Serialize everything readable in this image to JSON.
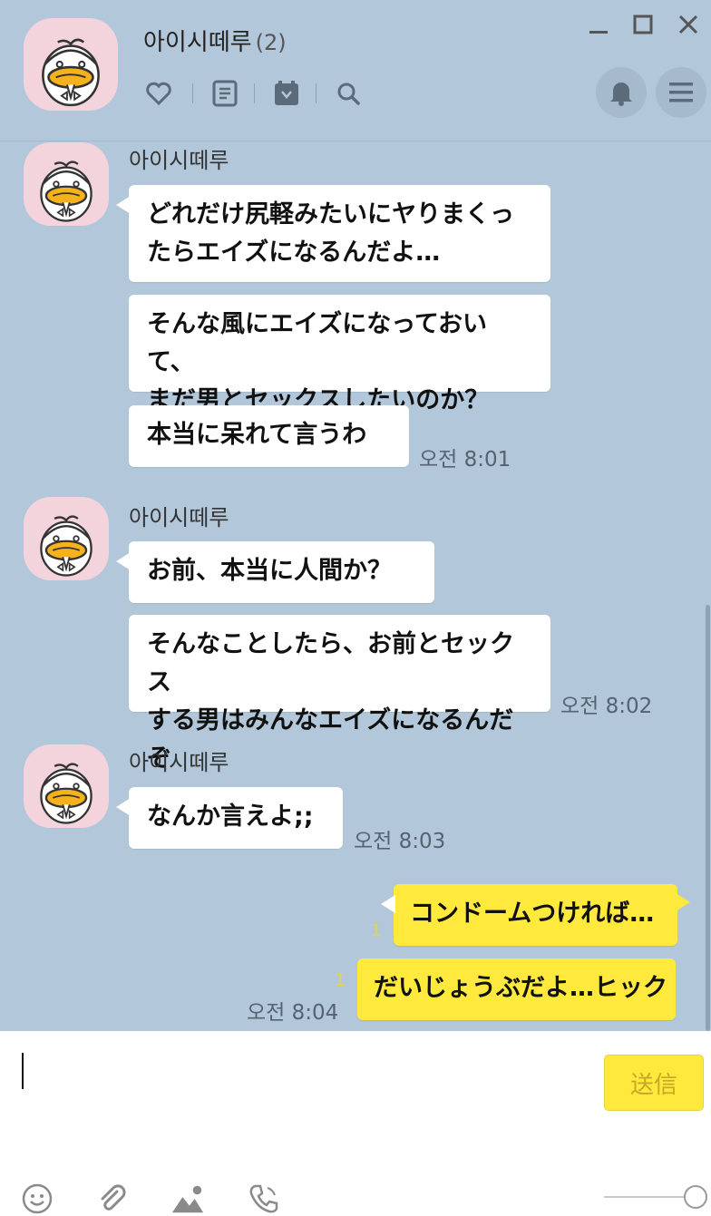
{
  "room": {
    "title": "아이시떼루",
    "count": "(2)"
  },
  "messages": {
    "g1": {
      "sender": "아이시떼루",
      "m1": "どれだけ尻軽みたいにヤりまくっ\nたらエイズになるんだよ…",
      "m2": "そんな風にエイズになっておいて、\nまだ男とセックスしたいのか？",
      "m3": "本当に呆れて言うわ",
      "time": "오전 8:01"
    },
    "g2": {
      "sender": "아이시떼루",
      "m1": "お前、本当に人間か？",
      "m2": "そんなことしたら、お前とセックス\nする男はみんなエイズになるんだぞ",
      "time": "오전 8:02"
    },
    "g3": {
      "sender": "아이시떼루",
      "m1": "なんか言えよ;;",
      "time": "오전 8:03"
    },
    "me": {
      "m1": "コンドームつければ…",
      "m2": "だいじょうぶだよ…ヒック",
      "unread1": "1",
      "unread2": "1",
      "time": "오전 8:04"
    }
  },
  "composer": {
    "send_label": "送信"
  },
  "icons": [
    "heart-icon",
    "notes-icon",
    "calendar-icon",
    "search-icon",
    "bell-icon",
    "menu-icon",
    "minimize-icon",
    "maximize-icon",
    "close-icon",
    "emoji-icon",
    "attach-icon",
    "image-icon",
    "call-icon"
  ],
  "colors": {
    "background": "#b2c7d9",
    "my_bubble": "#fee93c",
    "other_bubble": "#ffffff",
    "avatar_bg": "#f3d4dc"
  }
}
